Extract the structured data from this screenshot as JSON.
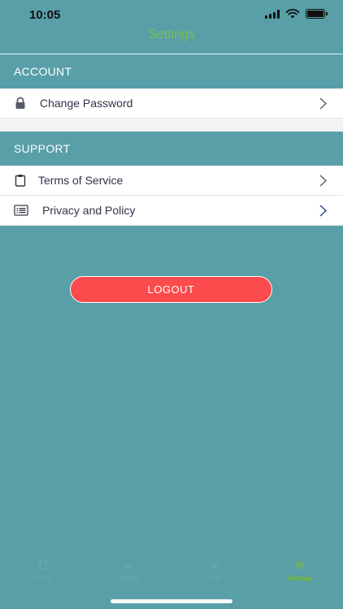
{
  "status_bar": {
    "time": "10:05"
  },
  "nav": {
    "title": "Settings"
  },
  "account_section": {
    "header": "ACCOUNT",
    "items": [
      {
        "label": "Change Password",
        "icon": "lock-icon"
      }
    ]
  },
  "support_section": {
    "header": "SUPPORT",
    "items": [
      {
        "label": "Terms of Service",
        "icon": "clipboard-icon"
      },
      {
        "label": "Privacy and Policy",
        "icon": "list-icon"
      }
    ]
  },
  "logout": {
    "label": "LOGOUT",
    "color": "#fb4b4c"
  },
  "tab_bar": {
    "tabs": [
      {
        "label": "Home",
        "icon": "home-icon",
        "active": false
      },
      {
        "label": "Ratings",
        "icon": "ratings-icon",
        "active": false
      },
      {
        "label": "Tools",
        "icon": "tools-icon",
        "active": false
      },
      {
        "label": "Settings",
        "icon": "gear-icon",
        "active": true
      }
    ],
    "active_color": "#7cba3d"
  },
  "colors": {
    "background": "#589fa8",
    "title": "#7bbf55"
  }
}
